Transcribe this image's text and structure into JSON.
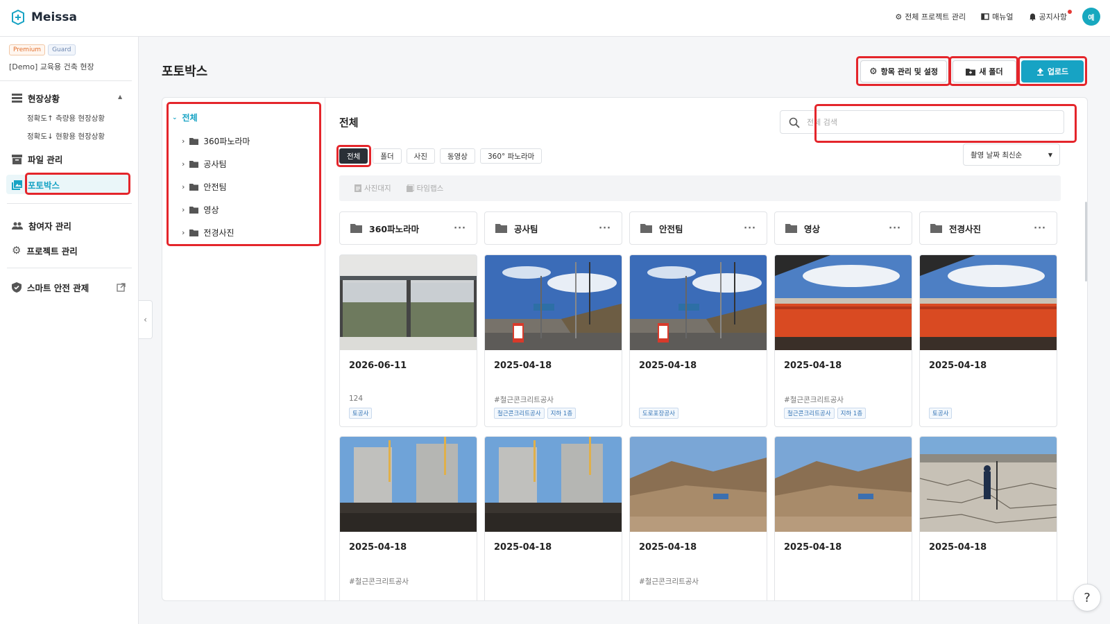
{
  "app": {
    "name": "Meissa"
  },
  "topnav": {
    "project_manage": "전체 프로젝트 관리",
    "manual": "매뉴얼",
    "notice": "공지사항",
    "avatar": "예"
  },
  "sidebar": {
    "badge_premium": "Premium",
    "badge_guard": "Guard",
    "project": "[Demo] 교육용 건축 현장",
    "status": "현장상황",
    "sub1": "정확도↑ 측량용 현장상황",
    "sub2": "정확도↓ 현황용 현장상황",
    "files": "파일 관리",
    "photobox": "포토박스",
    "members": "참여자 관리",
    "project_settings": "프로젝트 관리",
    "smart_safety": "스마트 안전 관제"
  },
  "page": {
    "title": "포토박스"
  },
  "actions": {
    "settings": "항목 관리 및 설정",
    "new_folder": "새 폴더",
    "upload": "업로드"
  },
  "tree": {
    "root": "전체",
    "items": [
      "360파노라마",
      "공사팀",
      "안전팀",
      "영상",
      "전경사진"
    ]
  },
  "content": {
    "title": "전체",
    "search_placeholder": "전체 검색",
    "filters": [
      "전체",
      "폴더",
      "사진",
      "동영상",
      "360° 파노라마"
    ],
    "sort": "촬영 날짜 최신순",
    "tools": [
      "사진대지",
      "타임랩스"
    ]
  },
  "folders": [
    "360파노라마",
    "공사팀",
    "안전팀",
    "영상",
    "전경사진"
  ],
  "photos": [
    {
      "date": "2026-06-11",
      "desc": "124",
      "tags": [
        "토공사"
      ],
      "scene": "window"
    },
    {
      "date": "2025-04-18",
      "desc": "#철근콘크리트공사",
      "tags": [
        "철근콘크리트공사",
        "지하 1층"
      ],
      "scene": "road"
    },
    {
      "date": "2025-04-18",
      "desc": "",
      "tags": [
        "도로포장공사"
      ],
      "scene": "road"
    },
    {
      "date": "2025-04-18",
      "desc": "#철근콘크리트공사",
      "tags": [
        "철근콘크리트공사",
        "지하 1층"
      ],
      "scene": "bridge"
    },
    {
      "date": "2025-04-18",
      "desc": "",
      "tags": [
        "토공사"
      ],
      "scene": "bridge"
    },
    {
      "date": "2025-04-18",
      "desc": "#철근콘크리트공사",
      "tags": [],
      "scene": "building"
    },
    {
      "date": "2025-04-18",
      "desc": "",
      "tags": [],
      "scene": "building"
    },
    {
      "date": "2025-04-18",
      "desc": "#철근콘크리트공사",
      "tags": [],
      "scene": "hill"
    },
    {
      "date": "2025-04-18",
      "desc": "",
      "tags": [],
      "scene": "hill"
    },
    {
      "date": "2025-04-18",
      "desc": "",
      "tags": [],
      "scene": "cracked"
    }
  ],
  "help": "?",
  "colors": {
    "accent": "#17a3c4",
    "highlight": "#e4252b"
  }
}
